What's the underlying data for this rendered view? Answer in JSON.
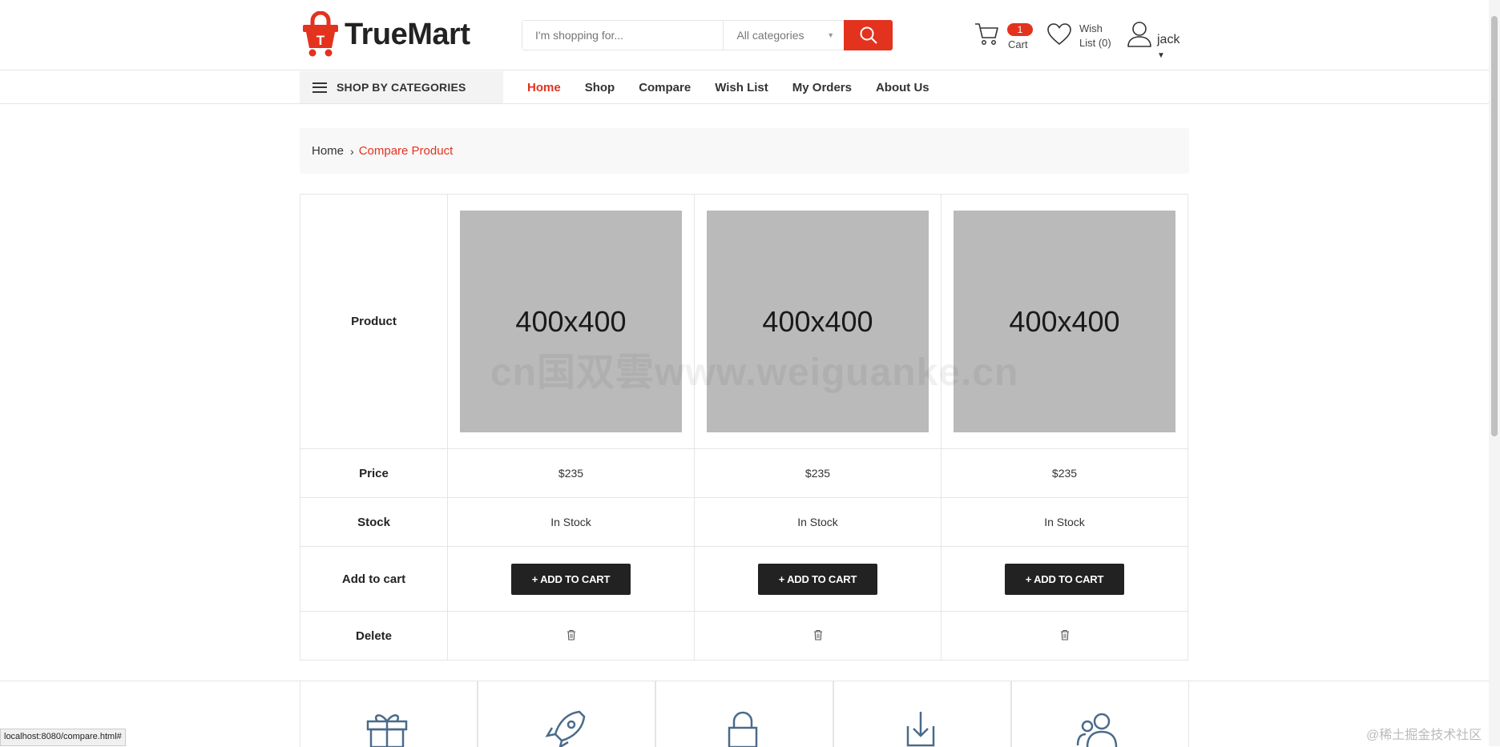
{
  "brand": {
    "name": "TrueMart",
    "logo_letter": "T"
  },
  "header": {
    "search_placeholder": "I'm shopping for...",
    "category_select": "All categories",
    "cart_count": "1",
    "cart_label": "Cart",
    "wish_line1": "Wish",
    "wish_line2": "List (0)",
    "username": "jack"
  },
  "nav": {
    "categories_button": "SHOP BY CATEGORIES",
    "items": [
      {
        "label": "Home",
        "active": true
      },
      {
        "label": "Shop"
      },
      {
        "label": "Compare"
      },
      {
        "label": "Wish List"
      },
      {
        "label": "My Orders"
      },
      {
        "label": "About Us"
      }
    ]
  },
  "breadcrumb": {
    "home": "Home",
    "current": "Compare Product"
  },
  "compare": {
    "row_labels": {
      "product": "Product",
      "price": "Price",
      "stock": "Stock",
      "add_to_cart": "Add to cart",
      "delete": "Delete"
    },
    "products": [
      {
        "image_text": "400x400",
        "price": "$235",
        "stock": "In Stock",
        "button": "+ ADD TO CART"
      },
      {
        "image_text": "400x400",
        "price": "$235",
        "stock": "In Stock",
        "button": "+ ADD TO CART"
      },
      {
        "image_text": "400x400",
        "price": "$235",
        "stock": "In Stock",
        "button": "+ ADD TO CART"
      }
    ]
  },
  "features": [
    "gift-icon",
    "rocket-icon",
    "lock-icon",
    "download-icon",
    "users-icon"
  ],
  "watermark": "cn国双雲www.weiguanke.cn",
  "status_bar": "localhost:8080/compare.html#",
  "corner_watermark": "@稀土掘金技术社区",
  "colors": {
    "accent": "#e3321e",
    "button_dark": "#222222",
    "placeholder_gray": "#bababa"
  }
}
